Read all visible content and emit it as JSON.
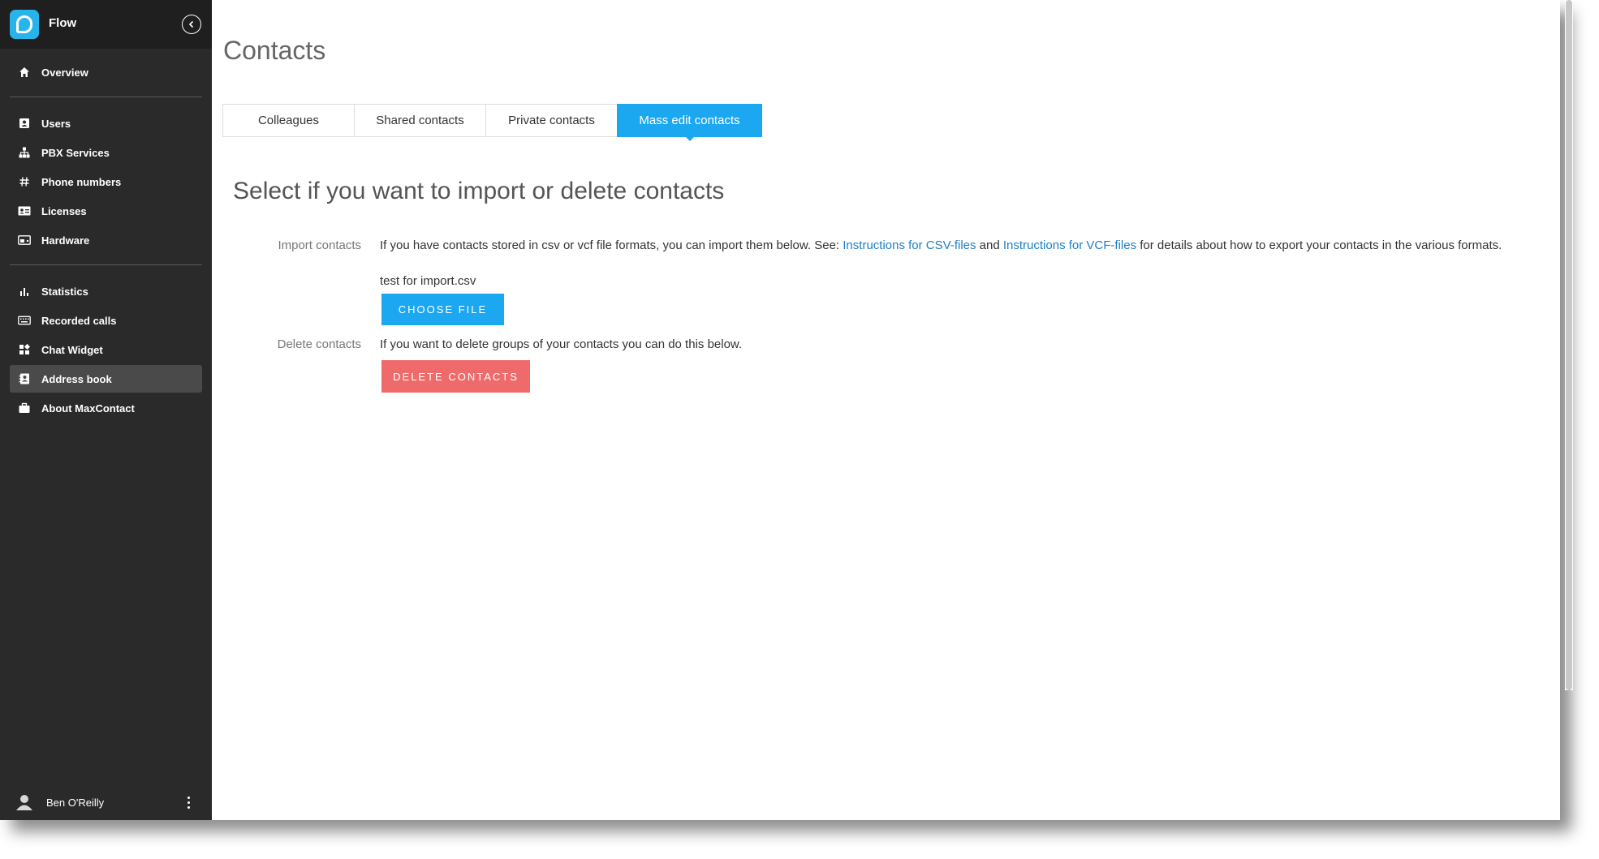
{
  "app": {
    "name": "Flow"
  },
  "sidebar": {
    "overview": {
      "label": "Overview",
      "icon": "home-icon"
    },
    "group1": [
      {
        "label": "Users",
        "icon": "contact-card-icon"
      },
      {
        "label": "PBX Services",
        "icon": "hierarchy-icon"
      },
      {
        "label": "Phone numbers",
        "icon": "hash-icon"
      },
      {
        "label": "Licenses",
        "icon": "id-card-icon"
      },
      {
        "label": "Hardware",
        "icon": "hardware-icon"
      }
    ],
    "group2": [
      {
        "label": "Statistics",
        "icon": "bar-chart-icon"
      },
      {
        "label": "Recorded calls",
        "icon": "keyboard-icon"
      },
      {
        "label": "Chat Widget",
        "icon": "widgets-icon"
      },
      {
        "label": "Address book",
        "icon": "address-book-icon",
        "active": true
      },
      {
        "label": "About MaxContact",
        "icon": "briefcase-icon"
      }
    ],
    "user": {
      "name": "Ben O'Reilly"
    }
  },
  "main": {
    "title": "Contacts",
    "tabs": [
      {
        "label": "Colleagues",
        "active": false
      },
      {
        "label": "Shared contacts",
        "active": false
      },
      {
        "label": "Private contacts",
        "active": false
      },
      {
        "label": "Mass edit contacts",
        "active": true
      }
    ],
    "section_title": "Select if you want to import or delete contacts",
    "import": {
      "label": "Import contacts",
      "text_before": "If you have contacts stored in csv or vcf file formats, you can import them below. See: ",
      "link_csv": "Instructions for CSV-files",
      "text_and": " and ",
      "link_vcf": "Instructions for VCF-files",
      "text_after": " for details about how to export your contacts in the various formats.",
      "file_name": "test for import.csv",
      "button": "CHOOSE FILE"
    },
    "delete": {
      "label": "Delete contacts",
      "text": "If you want to delete groups of your contacts you can do this below.",
      "button": "DELETE CONTACTS"
    }
  },
  "colors": {
    "sidebar_bg": "#2a2a2a",
    "accent_blue": "#1ba8f1",
    "danger_red": "#ef6b6b",
    "link": "#1f7fc7"
  }
}
